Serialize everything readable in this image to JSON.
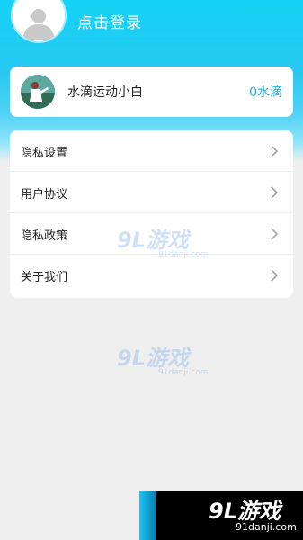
{
  "header": {
    "login_label": "点击登录"
  },
  "points_card": {
    "name": "水滴运动小白",
    "value": "0水滴"
  },
  "menu": {
    "items": [
      {
        "label": "隐私设置"
      },
      {
        "label": "用户协议"
      },
      {
        "label": "隐私政策"
      },
      {
        "label": "关于我们"
      }
    ]
  },
  "watermarks": {
    "main": "9L游戏",
    "sub": "91danji.com"
  },
  "corner_brand": {
    "main": "9L游戏",
    "url": "91danji.com"
  },
  "colors": {
    "header_top": "#14d3f6",
    "accent": "#19b6e2",
    "background": "#efefef"
  },
  "icons": {
    "avatar": "user-silhouette-icon",
    "chevron": "chevron-right-icon"
  }
}
